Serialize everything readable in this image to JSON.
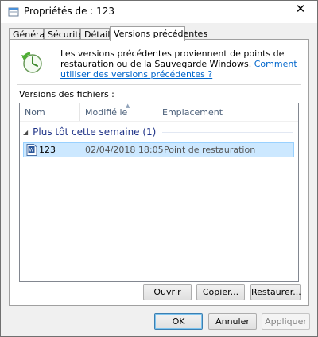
{
  "window": {
    "title": "Propriétés de : 123",
    "close_glyph": "✕"
  },
  "tabs": [
    {
      "label": "Général",
      "active": false
    },
    {
      "label": "Sécurité",
      "active": false
    },
    {
      "label": "Détails",
      "active": false
    },
    {
      "label": "Versions précédentes",
      "active": true
    }
  ],
  "description": {
    "text": "Les versions précédentes proviennent de points de restauration ou de la Sauvegarde Windows.",
    "link": "Comment utiliser des versions précédentes ?"
  },
  "file_versions_label": "Versions des fichiers :",
  "columns": [
    "Nom",
    "Modifié le",
    "Emplacement"
  ],
  "group": {
    "label": "Plus tôt cette semaine (1)"
  },
  "rows": [
    {
      "name": "123",
      "modified": "02/04/2018 18:05",
      "location": "Point de restauration",
      "selected": true
    }
  ],
  "actions": {
    "open": "Ouvrir",
    "copy": "Copier...",
    "restore": "Restaurer..."
  },
  "dialog_buttons": {
    "ok": "OK",
    "cancel": "Annuler",
    "apply": "Appliquer"
  },
  "colors": {
    "link": "#0066cc",
    "group_header": "#1e3287",
    "selection_bg": "#cce8ff",
    "selection_border": "#99d1ff"
  },
  "icons": {
    "title": "properties-icon",
    "restore": "restore-clock-icon",
    "file": "document-icon",
    "group_toggle": "collapse-triangle-icon"
  }
}
